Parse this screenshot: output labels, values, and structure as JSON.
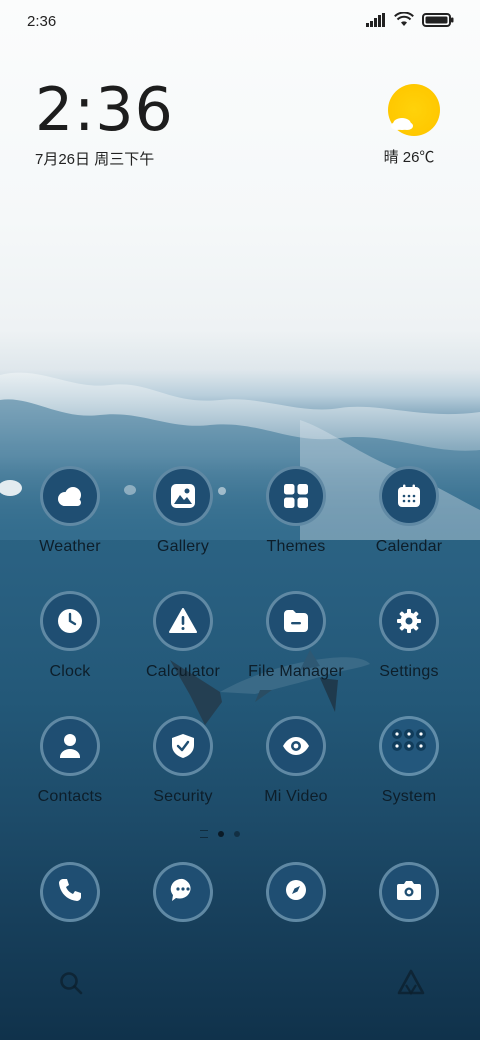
{
  "status_bar": {
    "time": "2:36"
  },
  "clock_widget": {
    "time": "2:36",
    "date": "7月26日 周三下午"
  },
  "weather_widget": {
    "condition_icon": "sun-cloud-icon",
    "text": "晴 26℃"
  },
  "apps": [
    {
      "label": "Weather",
      "icon": "weather-cloud-icon"
    },
    {
      "label": "Gallery",
      "icon": "gallery-image-icon"
    },
    {
      "label": "Themes",
      "icon": "themes-grid-icon"
    },
    {
      "label": "Calendar",
      "icon": "calendar-icon"
    },
    {
      "label": "Clock",
      "icon": "clock-icon"
    },
    {
      "label": "Calculator",
      "icon": "calculator-warning-icon"
    },
    {
      "label": "File Manager",
      "icon": "folder-icon"
    },
    {
      "label": "Settings",
      "icon": "gear-icon"
    },
    {
      "label": "Contacts",
      "icon": "person-icon"
    },
    {
      "label": "Security",
      "icon": "shield-check-icon"
    },
    {
      "label": "Mi Video",
      "icon": "eye-icon"
    },
    {
      "label": "System",
      "icon": "folder-grid-icon"
    }
  ],
  "dock": [
    {
      "icon": "phone-icon"
    },
    {
      "icon": "message-icon"
    },
    {
      "icon": "browser-compass-icon"
    },
    {
      "icon": "camera-icon"
    }
  ],
  "page_indicator": {
    "pages": 2,
    "current": 1
  },
  "colors": {
    "icon_bg": "#1f4e72",
    "icon_ring": "#96b9cd",
    "sun": "#ffc800"
  }
}
